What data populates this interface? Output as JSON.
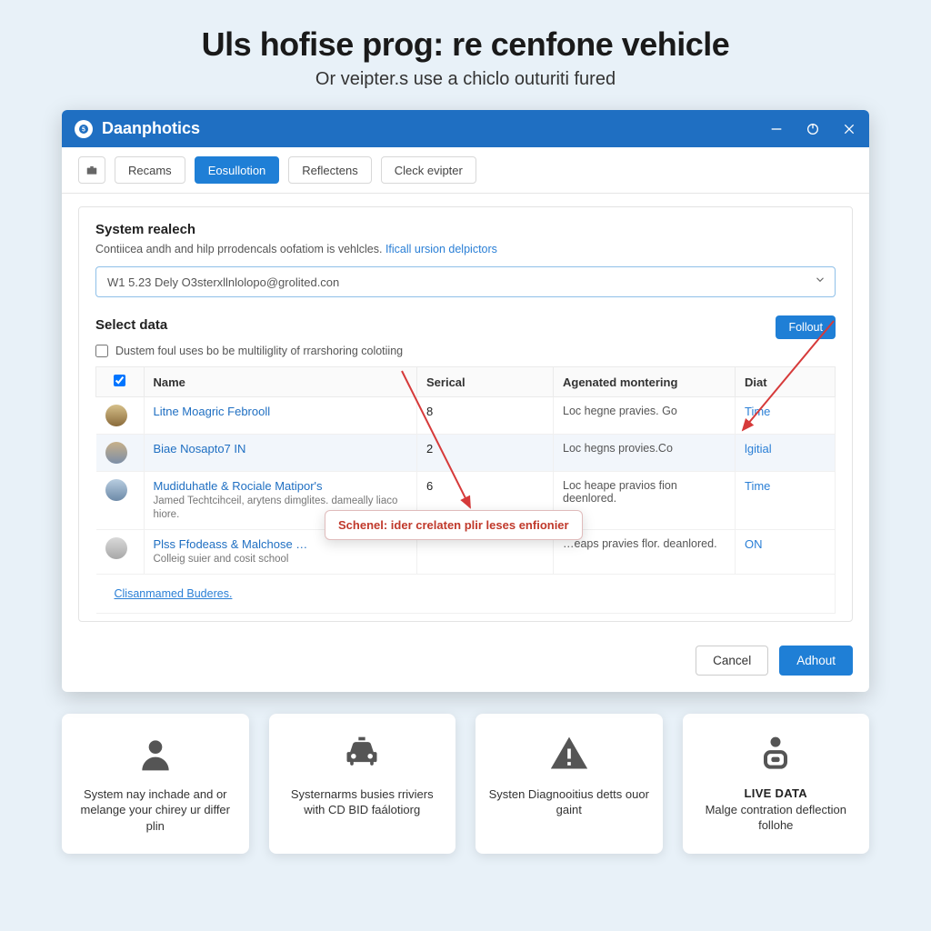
{
  "header": {
    "title": "Uls hofise prog: re cenfone vehicle",
    "subtitle": "Or veipter.s use a chiclo outuriti fured"
  },
  "window": {
    "app_name": "Daanphotics",
    "tabs": {
      "home_icon": "briefcase",
      "items": [
        "Recams",
        "Eosullotion",
        "Reflectens",
        "Cleck evipter"
      ],
      "active_index": 1
    }
  },
  "panel": {
    "section1_title": "System realech",
    "section1_sub_text": "Contiicea andh and hilp prrodencals oofatiom is vehlcles. ",
    "section1_sub_link": "Ificall ursion delpictors",
    "select_value": "W1 5.23 Dely O3sterxllnlolopo@grolited.con",
    "section2_title": "Select data",
    "follout_label": "Follout",
    "checkbox_label": "Dustem foul uses bo be multiliglity of rrarshoring colotiing",
    "checkbox_checked": false,
    "columns": [
      "",
      "Name",
      "Serical",
      "Agenated montering",
      "Diat"
    ],
    "rows": [
      {
        "avatar_color": "linear-gradient(#d6c08a,#8a6b3b)",
        "name": "Litne Moagric Febrooll",
        "secondary": "",
        "serical": "8",
        "monitoring": "Loc hegne pravies. Go",
        "diat": "Time",
        "selected": false
      },
      {
        "avatar_color": "linear-gradient(#c7b089,#7c8ea7)",
        "name": "Biae Nosapto7 IN",
        "secondary": "",
        "serical": "2",
        "monitoring": "Loc hegns provies.Co",
        "diat": "lgitial",
        "selected": true
      },
      {
        "avatar_color": "linear-gradient(#b8cde0,#6d8aa8)",
        "name": "Mudiduhatle & Rociale Matipor's",
        "secondary": "Jamed Techtcihceil, arytens dimglites. dameally liaco hiore.",
        "serical": "6",
        "monitoring": "Loc heape pravios fion deenlored.",
        "diat": "Time",
        "selected": false
      },
      {
        "avatar_color": "linear-gradient(#d9d9d9,#a8a8a8)",
        "name": "Plss Ffodeass & Malchose …",
        "secondary": "Colleig suier and cosit school",
        "serical": "",
        "monitoring": "…eaps pravies flor. deanlored.",
        "diat": "ON",
        "selected": false
      }
    ],
    "expand_link": "Clisanmamed Buderes.",
    "tooltip_text": "Schenel: ider crelaten plir leses enfionier"
  },
  "footer": {
    "cancel": "Cancel",
    "about": "Adhout"
  },
  "cards": [
    {
      "icon": "person",
      "title": "",
      "text": "System nay inchade and or melange your chirey ur differ plin"
    },
    {
      "icon": "car",
      "title": "",
      "text": "Systernarms busies rriviers with CD BID faálotiorg"
    },
    {
      "icon": "warning",
      "title": "",
      "text": "Systen Diagnooitius detts ouor gaint"
    },
    {
      "icon": "camera",
      "title": "LIVE DATA",
      "text": "Malge contration deflection follohe"
    }
  ]
}
